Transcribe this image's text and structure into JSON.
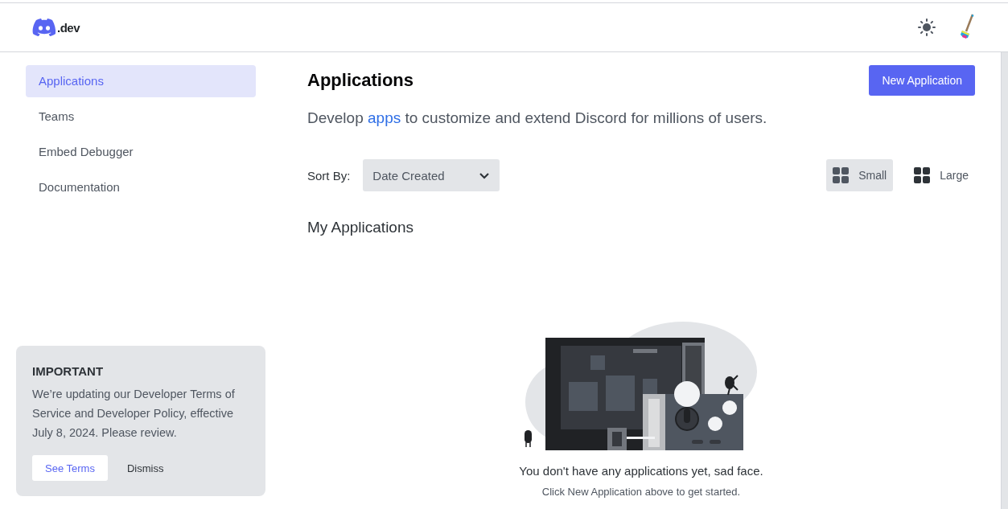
{
  "header": {
    "logo_text": ".dev"
  },
  "sidebar": {
    "items": [
      {
        "label": "Applications",
        "selected": true
      },
      {
        "label": "Teams",
        "selected": false
      },
      {
        "label": "Embed Debugger",
        "selected": false
      },
      {
        "label": "Documentation",
        "selected": false
      }
    ]
  },
  "notice": {
    "title": "IMPORTANT",
    "body": "We’re updating our Developer Terms of Service and Developer Policy, effective July 8, 2024. Please review.",
    "buttons": [
      {
        "label": "See Terms",
        "kind": "primary"
      },
      {
        "label": "Dismiss",
        "kind": "plain"
      }
    ]
  },
  "main": {
    "title": "Applications",
    "new_button": "New Application",
    "subtitle": {
      "before": "Develop",
      "link": "apps",
      "after": "to customize and extend Discord for millions of users."
    },
    "sort": {
      "label": "Sort By:",
      "value": "Date Created"
    },
    "views": [
      {
        "label": "Small",
        "selected": true
      },
      {
        "label": "Large",
        "selected": false
      }
    ],
    "section_title": "My Applications",
    "empty": {
      "message": "You don't have any applications yet, sad face.",
      "hint": "Click New Application above to get started."
    }
  }
}
